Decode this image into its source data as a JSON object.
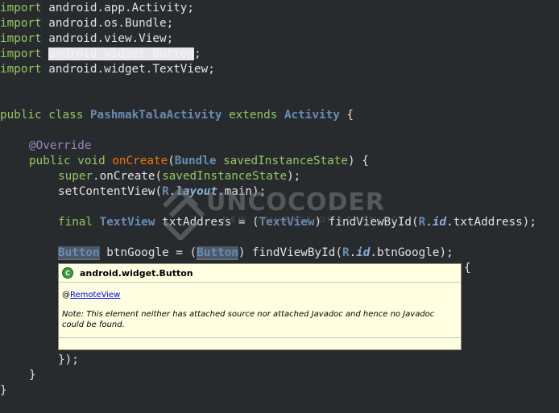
{
  "code": {
    "l1": {
      "kw": "import",
      "rest": " android.app.Activity;"
    },
    "l2": {
      "kw": "import",
      "rest": " android.os.Bundle;"
    },
    "l3": {
      "kw": "import",
      "rest": " android.view.View;"
    },
    "l4": {
      "kw": "import",
      "sel": "android.widget.Button",
      "end": ";"
    },
    "l5": {
      "kw": "import",
      "rest": " android.widget.TextView;"
    },
    "l6": {
      "kw1": "public",
      "kw2": "class",
      "name": "PashmakTalaActivity",
      "kw3": "extends",
      "sup": "Activity",
      "end": " {"
    },
    "l7": {
      "anno": "@Override"
    },
    "l8": {
      "kw1": "public",
      "kw2": "void",
      "meth": "onCreate",
      "p1": "(",
      "type": "Bundle",
      "param": "savedInstanceState",
      "end": ") {"
    },
    "l9": {
      "kw": "super",
      "mid": ".onCreate(",
      "field": "savedInstanceState",
      "end": ");"
    },
    "l10": {
      "pre": "setContentView(",
      "r": "R",
      "dot1": ".",
      "layout": "layout",
      "end": ".main);"
    },
    "l11": {
      "kw": "final",
      "type": "TextView",
      "mid": " txtAddress = (",
      "cast": "TextView",
      "end": ") findViewById(",
      "r": "R",
      "dot": ".",
      "id": "id",
      "tail": ".txtAddress);"
    },
    "l12": {
      "type": "Button",
      "mid": " btnGoogle = (",
      "cast": "Button",
      "end": ") findViewById(",
      "r": "R",
      "dot": ".",
      "id": "id",
      "tail": ".btnGoogle);"
    },
    "l12b": {
      "text": "{"
    },
    "l13": {
      "text": "});"
    },
    "l14": {
      "text": "}"
    },
    "l15": {
      "text": "}"
    }
  },
  "watermark": {
    "text": "UNCOCODER",
    "sub": "NEW UNIVERSE OF LEARNING"
  },
  "tooltip": {
    "icon": "C",
    "title": "android.widget.Button",
    "anno_prefix": "@",
    "anno_link": "RemoteView",
    "note": "Note: This element neither has attached source nor attached Javadoc and hence no Javadoc could be found."
  }
}
